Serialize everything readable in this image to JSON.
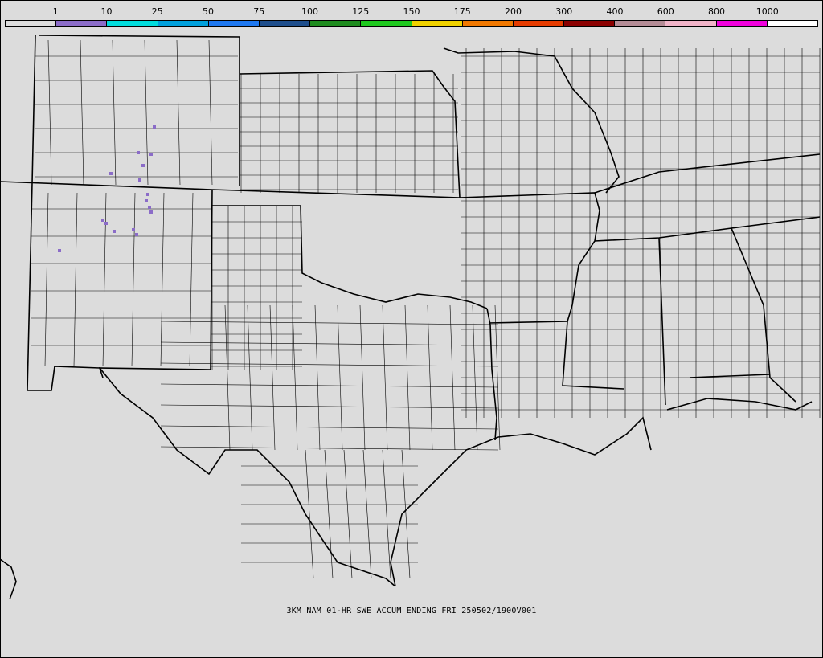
{
  "legend": {
    "labels": [
      "1",
      "10",
      "25",
      "50",
      "75",
      "100",
      "125",
      "150",
      "175",
      "200",
      "300",
      "400",
      "600",
      "800",
      "1000"
    ],
    "colors": [
      "#dcdcdc",
      "#8b6cc8",
      "#00dcdc",
      "#00a0dc",
      "#1e78f0",
      "#1e4e8c",
      "#1e8c1e",
      "#1ec81e",
      "#f0d200",
      "#f07800",
      "#e63c00",
      "#8b0000",
      "#b48c96",
      "#f0b4c8",
      "#f000dc",
      "#ffffff"
    ]
  },
  "map": {
    "background": "#dcdcdc",
    "snow_color": "#8b6cc8"
  },
  "caption": "3KM NAM 01-HR SWE ACCUM ENDING FRI 250502/1900V001"
}
